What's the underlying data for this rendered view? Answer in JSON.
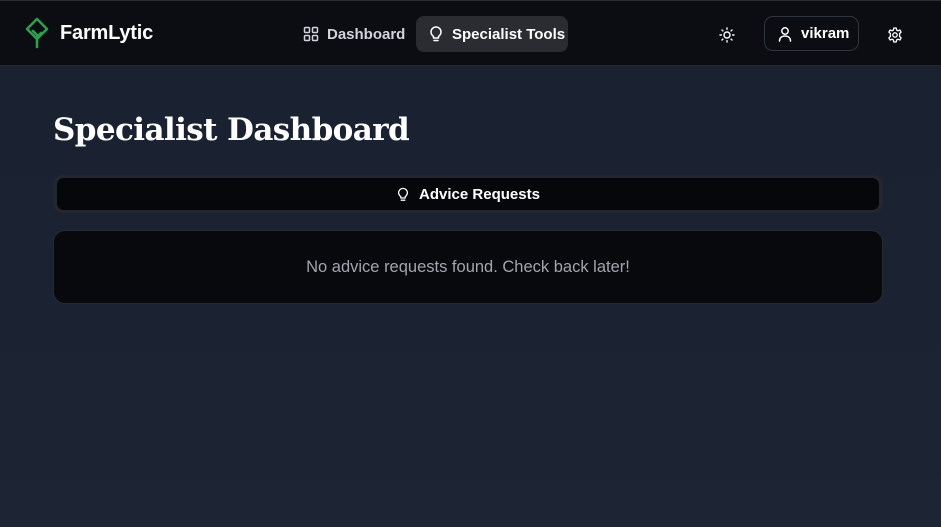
{
  "app": {
    "brand": "FarmLytic",
    "brand_color": "#2e9e4f"
  },
  "nav": {
    "items": [
      {
        "label": "Dashboard",
        "icon": "grid-icon",
        "active": false
      },
      {
        "label": "Specialist Tools",
        "icon": "lightbulb-icon",
        "active": true
      }
    ],
    "theme_icon": "sun-icon",
    "user": {
      "name": "vikram",
      "icon": "user-icon"
    },
    "settings_icon": "gear-icon"
  },
  "page": {
    "title": "Specialist Dashboard",
    "tabs": [
      {
        "label": "Advice Requests",
        "icon": "lightbulb-icon",
        "active": true
      }
    ],
    "empty_message": "No advice requests found. Check back later!"
  }
}
